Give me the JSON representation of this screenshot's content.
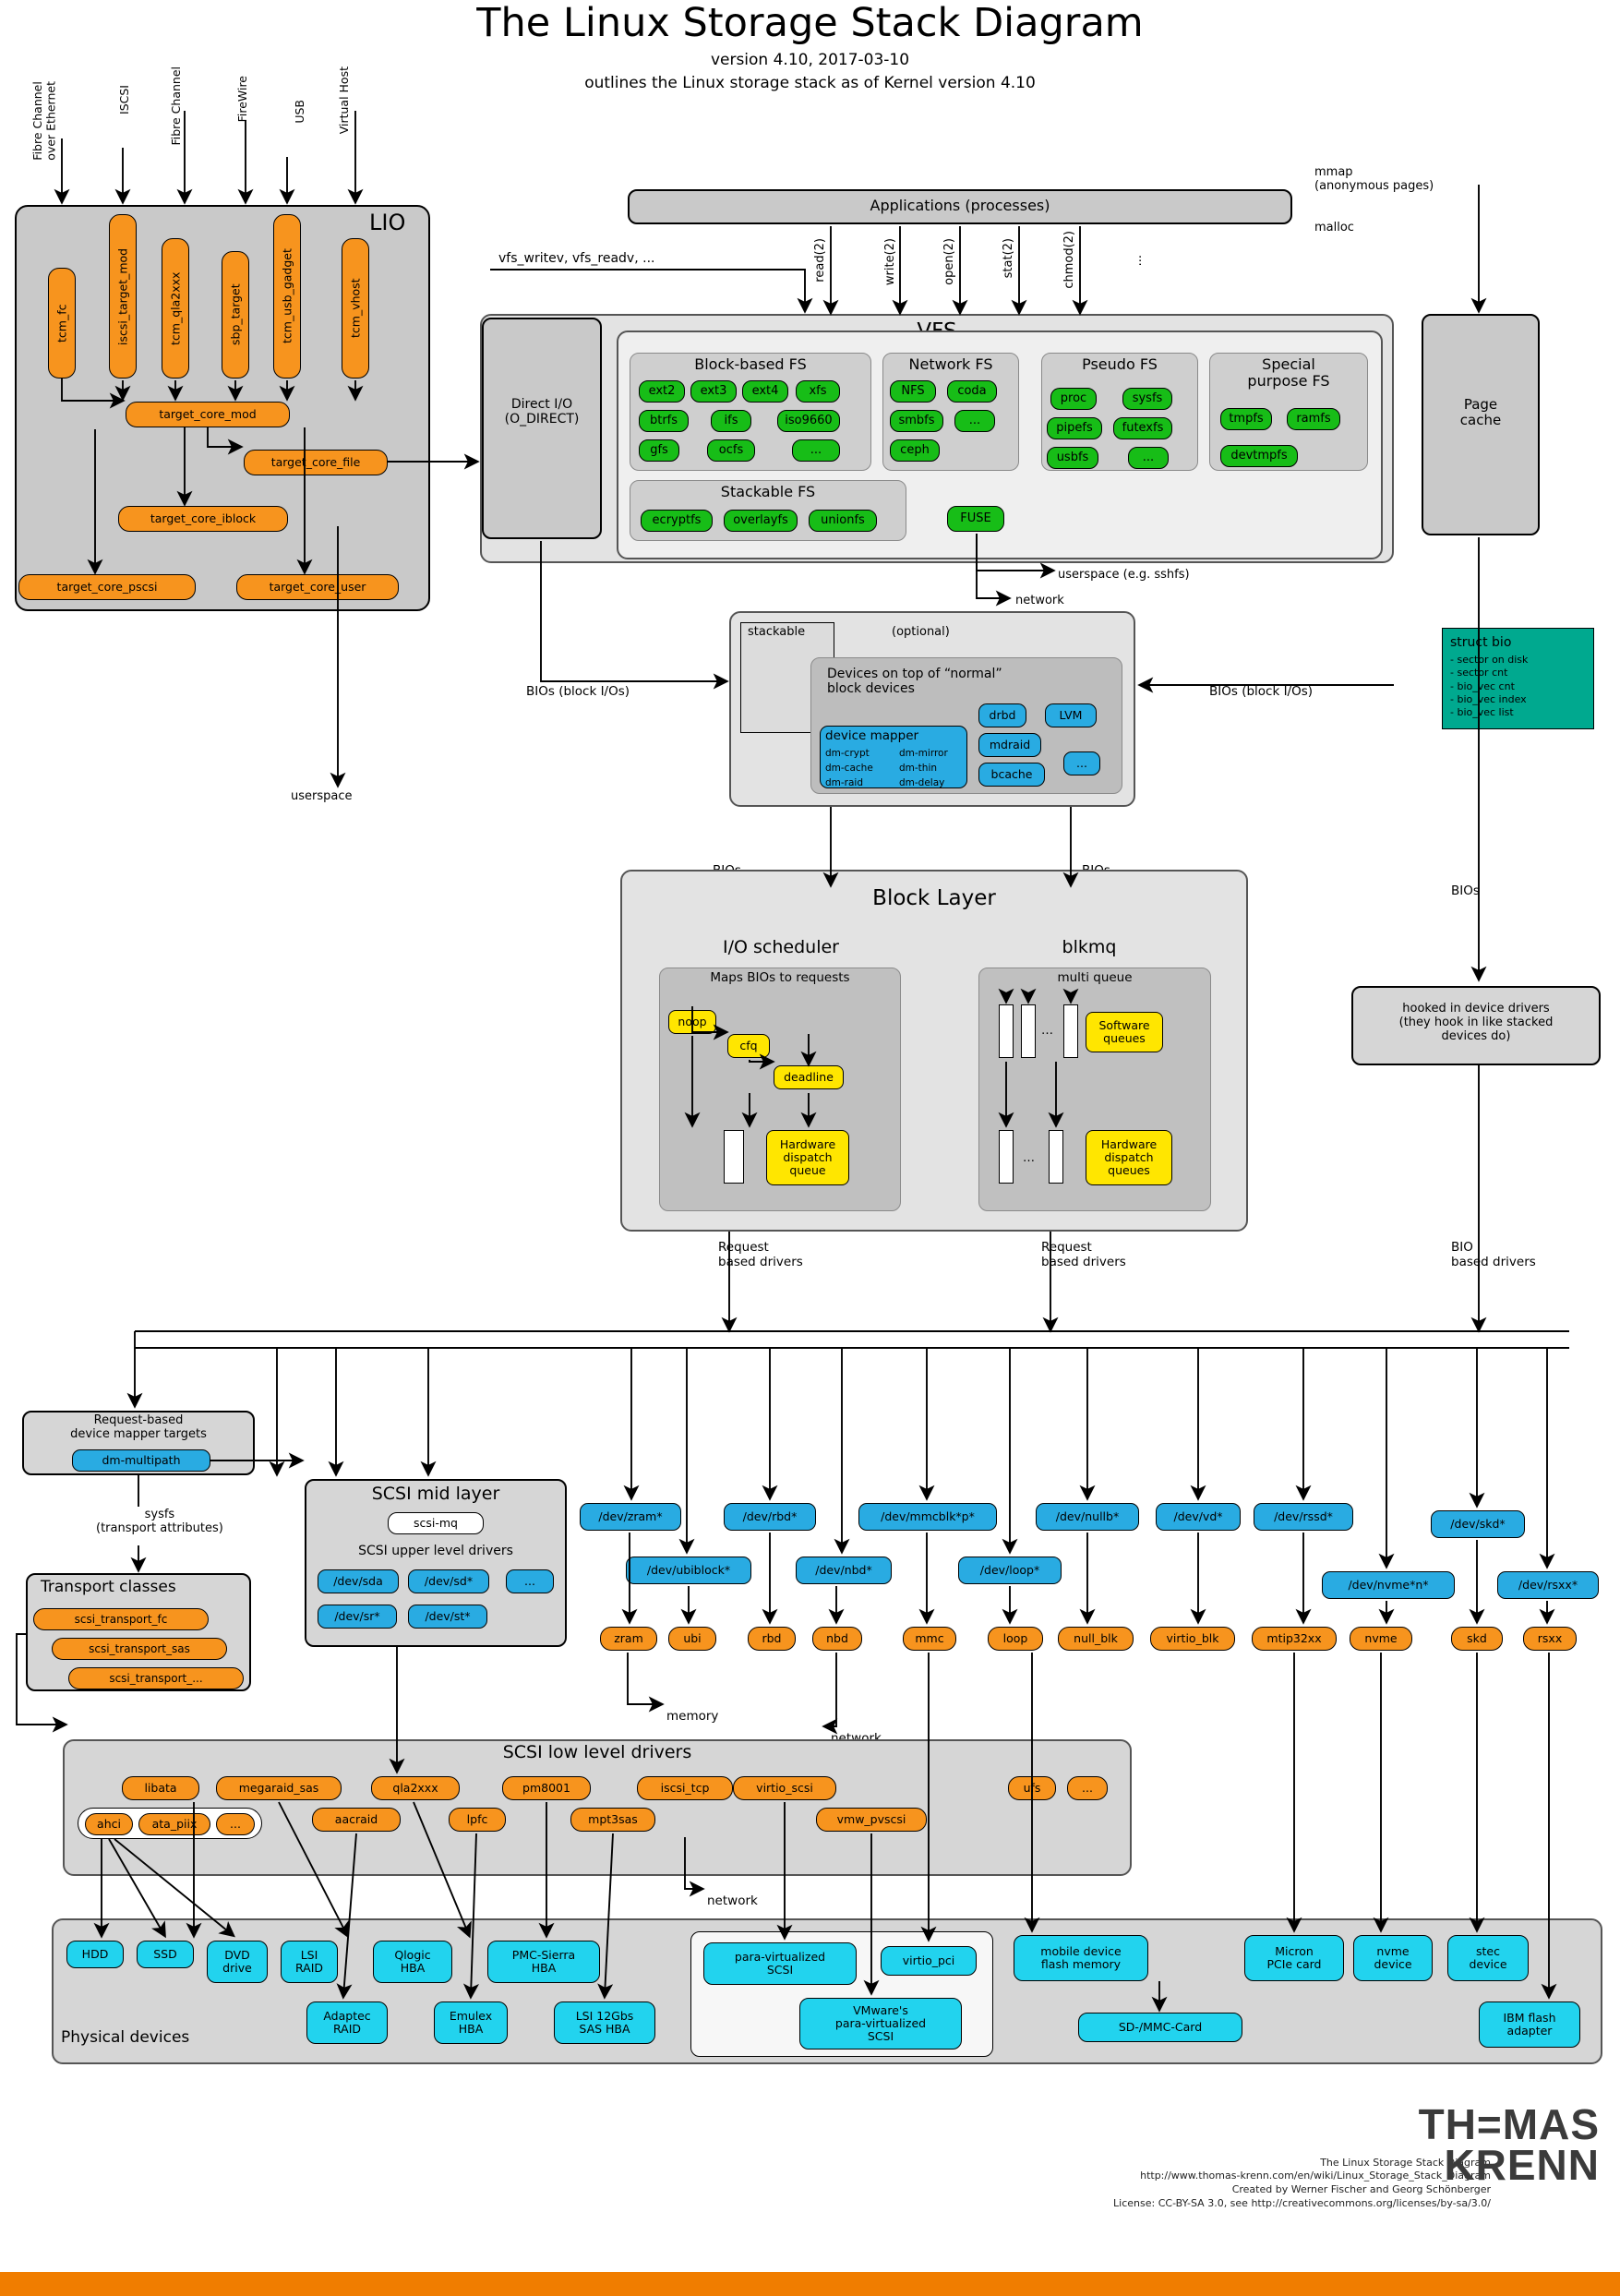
{
  "title": "The Linux Storage Stack Diagram",
  "subtitle1": "version 4.10, 2017-03-10",
  "subtitle2": "outlines the Linux storage stack as of Kernel version 4.10",
  "top_arrows": [
    {
      "label": "Fibre Channel\nover Ethernet"
    },
    {
      "label": "ISCSI"
    },
    {
      "label": "Fibre Channel"
    },
    {
      "label": "FireWire"
    },
    {
      "label": "USB"
    },
    {
      "label": "Virtual Host"
    }
  ],
  "lio": {
    "title": "LIO",
    "fabric_modules": [
      "tcm_fc",
      "iscsi_target_mod",
      "tcm_qla2xxx",
      "sbp_target",
      "tcm_usb_gadget",
      "tcm_vhost"
    ],
    "core": "target_core_mod",
    "backends": [
      "target_core_file",
      "target_core_iblock",
      "target_core_pscsi",
      "target_core_user"
    ],
    "userspace_label": "userspace"
  },
  "applications": "Applications (processes)",
  "syscalls": [
    "read(2)",
    "write(2)",
    "open(2)",
    "stat(2)",
    "chmod(2)",
    "..."
  ],
  "mmap_label": "mmap\n(anonymous pages)",
  "malloc_label": "malloc",
  "vfs_writev_label": "vfs_writev, vfs_readv, ...",
  "direct_io": "Direct I/O\n(O_DIRECT)",
  "vfs": {
    "title": "VFS",
    "block_fs": {
      "title": "Block-based FS",
      "items": [
        "ext2",
        "ext3",
        "ext4",
        "xfs",
        "btrfs",
        "ifs",
        "iso9660",
        "gfs",
        "ocfs",
        "..."
      ]
    },
    "network_fs": {
      "title": "Network FS",
      "items": [
        "NFS",
        "coda",
        "smbfs",
        "...",
        "ceph"
      ]
    },
    "pseudo_fs": {
      "title": "Pseudo FS",
      "items": [
        "proc",
        "sysfs",
        "pipefs",
        "futexfs",
        "usbfs",
        "..."
      ]
    },
    "special_fs": {
      "title": "Special\npurpose FS",
      "items": [
        "tmpfs",
        "ramfs",
        "devtmpfs"
      ]
    },
    "stackable_fs": {
      "title": "Stackable FS",
      "items": [
        "ecryptfs",
        "overlayfs",
        "unionfs"
      ]
    },
    "fuse": "FUSE",
    "fuse_userspace": "userspace (e.g. sshfs)",
    "fuse_network": "network"
  },
  "page_cache": "Page\ncache",
  "struct_bio": {
    "title": "struct bio",
    "fields": [
      "- sector on disk",
      "- sector cnt",
      "- bio_vec cnt",
      "- bio_vec index",
      "- bio_vec list"
    ]
  },
  "bios_label": "BIOs (block I/Os)",
  "bios_short": "BIOs",
  "devmapper": {
    "stackable": "stackable",
    "optional": "(optional)",
    "heading": "Devices on top of “normal”\nblock devices",
    "dm_title": "device mapper",
    "dm_items": [
      "dm-crypt",
      "dm-mirror",
      "dm-cache",
      "dm-thin",
      "dm-raid",
      "dm-delay"
    ],
    "others": [
      "drbd",
      "LVM",
      "mdraid",
      "bcache",
      "..."
    ]
  },
  "block_layer": {
    "title": "Block Layer",
    "io_scheduler": {
      "title": "I/O scheduler",
      "maps": "Maps BIOs to requests",
      "schedulers": [
        "noop",
        "cfq",
        "deadline"
      ],
      "hw_queue": "Hardware\ndispatch\nqueue"
    },
    "blkmq": {
      "title": "blkmq",
      "multi_queue": "multi queue",
      "software_queues": "Software\nqueues",
      "hw_queues": "Hardware\ndispatch\nqueues"
    },
    "request_based_drivers": "Request\nbased drivers",
    "bio_based_drivers": "BIO\nbased drivers"
  },
  "hooked": "hooked in device drivers\n(they hook in like stacked\ndevices do)",
  "request_dm": {
    "title": "Request-based\ndevice mapper targets",
    "item": "dm-multipath"
  },
  "sysfs_label": "sysfs\n(transport attributes)",
  "transport_classes": {
    "title": "Transport classes",
    "items": [
      "scsi_transport_fc",
      "scsi_transport_sas",
      "scsi_transport_..."
    ]
  },
  "scsi_mid": {
    "title": "SCSI mid layer",
    "mq": "scsi-mq",
    "upper": "SCSI upper level drivers",
    "devices": [
      "/dev/sda",
      "/dev/sd*",
      "...",
      "/dev/sr*",
      "/dev/st*"
    ]
  },
  "device_nodes": [
    "/dev/zram*",
    "/dev/rbd*",
    "/dev/mmcblk*p*",
    "/dev/nullb*",
    "/dev/vd*",
    "/dev/rssd*",
    "/dev/skd*",
    "/dev/ubiblock*",
    "/dev/nbd*",
    "/dev/loop*",
    "/dev/nvme*n*",
    "/dev/rsxx*"
  ],
  "block_drivers": [
    "zram",
    "ubi",
    "rbd",
    "nbd",
    "mmc",
    "loop",
    "null_blk",
    "virtio_blk",
    "mtip32xx",
    "nvme",
    "skd",
    "rsxx"
  ],
  "memory_label": "memory",
  "network_label": "network",
  "scsi_low": {
    "title": "SCSI low level drivers",
    "row1": [
      "libata",
      "megaraid_sas",
      "qla2xxx",
      "pm8001",
      "iscsi_tcp",
      "virtio_scsi",
      "ufs",
      "..."
    ],
    "row2": [
      "ahci",
      "ata_piix",
      "...",
      "aacraid",
      "lpfc",
      "mpt3sas",
      "vmw_pvscsi"
    ]
  },
  "physical": {
    "title": "Physical devices",
    "row1": [
      "HDD",
      "SSD",
      "DVD\ndrive",
      "LSI\nRAID",
      "Qlogic\nHBA",
      "PMC-Sierra\nHBA"
    ],
    "row2": [
      "Adaptec\nRAID",
      "Emulex\nHBA",
      "LSI 12Gbs\nSAS HBA"
    ],
    "paravirt": "para-virtualized\nSCSI",
    "virtio_pci": "virtio_pci",
    "vmware": "VMware's\npara-virtualized\nSCSI",
    "mobile": "mobile device\nflash memory",
    "sdmmc": "SD-/MMC-Card",
    "micron": "Micron\nPCIe card",
    "nvme_dev": "nvme\ndevice",
    "stec": "stec\ndevice",
    "ibm": "IBM flash\nadapter"
  },
  "footer": {
    "line1": "The Linux Storage Stack Diagram",
    "line2": "http://www.thomas-krenn.com/en/wiki/Linux_Storage_Stack_Diagram",
    "line3": "Created by Werner Fischer and Georg Schönberger",
    "line4": "License: CC-BY-SA 3.0, see http://creativecommons.org/licenses/by-sa/3.0/",
    "brand1": "TH=MAS",
    "brand2": "KRENN"
  },
  "colors": {
    "orange": "#f7941e",
    "green": "#17bd17",
    "cyan": "#22d3ee",
    "blue": "#29abe2",
    "yellow": "#ffe600",
    "teal": "#00a98f",
    "brand_bar": "#f07d00"
  }
}
